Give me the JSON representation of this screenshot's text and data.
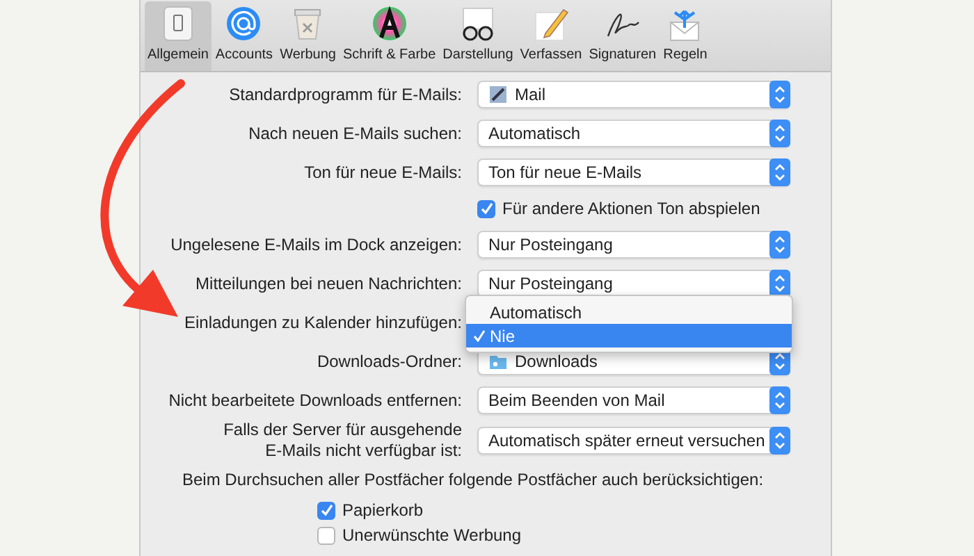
{
  "toolbar": {
    "tabs": [
      {
        "label": "Allgemein",
        "selected": true
      },
      {
        "label": "Accounts",
        "selected": false
      },
      {
        "label": "Werbung",
        "selected": false
      },
      {
        "label": "Schrift & Farbe",
        "selected": false
      },
      {
        "label": "Darstellung",
        "selected": false
      },
      {
        "label": "Verfassen",
        "selected": false
      },
      {
        "label": "Signaturen",
        "selected": false
      },
      {
        "label": "Regeln",
        "selected": false
      }
    ]
  },
  "settings": [
    {
      "kind": "popup",
      "label": "Standardprogramm für E-Mails:",
      "value": "Mail"
    },
    {
      "kind": "popup",
      "label": "Nach neuen E-Mails suchen:",
      "value": "Automatisch"
    },
    {
      "kind": "popup",
      "label": "Ton für neue E-Mails:",
      "value": "Ton für neue E-Mails"
    },
    {
      "kind": "checkbox",
      "label": "Für andere Aktionen Ton abspielen",
      "checked": true
    },
    {
      "kind": "popup",
      "label": "Ungelesene E-Mails im Dock anzeigen:",
      "value": "Nur Posteingang"
    },
    {
      "kind": "popup",
      "label": "Mitteilungen bei neuen Nachrichten:",
      "value": "Nur Posteingang"
    },
    {
      "kind": "popup",
      "label": "Einladungen zu Kalender hinzufügen:",
      "menu": [
        {
          "label": "Automatisch",
          "selected": false
        },
        {
          "label": "Nie",
          "selected": true
        }
      ]
    },
    {
      "kind": "popup",
      "label": "Downloads-Ordner:",
      "value": "Downloads"
    },
    {
      "kind": "popup",
      "label": "Nicht bearbeitete Downloads entfernen:",
      "value": "Beim Beenden von Mail"
    },
    {
      "kind": "popup",
      "label": "Falls der Server für ausgehende\nE-Mails nicht verfügbar ist:",
      "value": "Automatisch später erneut versuchen"
    },
    {
      "kind": "heading",
      "label": "Beim Durchsuchen aller Postfächer folgende Postfächer auch berücksichtigen:"
    },
    {
      "kind": "checkbox",
      "label": "Papierkorb",
      "checked": true,
      "indent": true
    },
    {
      "kind": "checkbox",
      "label": "Unerwünschte Werbung",
      "checked": false,
      "indent": true
    }
  ]
}
